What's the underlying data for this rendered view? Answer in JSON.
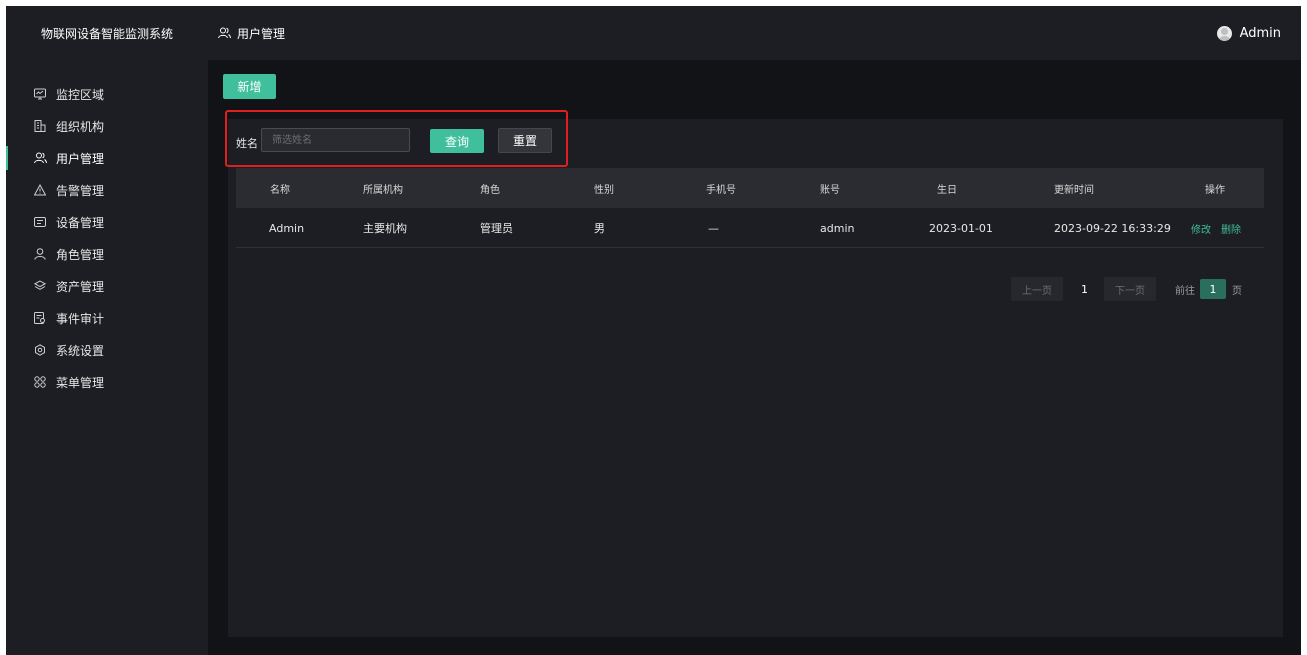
{
  "app": {
    "title": "物联网设备智能监测系统"
  },
  "sidebar": {
    "items": [
      {
        "label": "监控区域",
        "icon": "monitor-icon"
      },
      {
        "label": "组织机构",
        "icon": "building-icon"
      },
      {
        "label": "用户管理",
        "icon": "users-icon",
        "active": true
      },
      {
        "label": "告警管理",
        "icon": "warning-icon"
      },
      {
        "label": "设备管理",
        "icon": "device-icon"
      },
      {
        "label": "角色管理",
        "icon": "user-icon"
      },
      {
        "label": "资产管理",
        "icon": "layers-icon"
      },
      {
        "label": "事件审计",
        "icon": "audit-icon"
      },
      {
        "label": "系统设置",
        "icon": "gear-icon"
      },
      {
        "label": "菜单管理",
        "icon": "grid-icon"
      }
    ]
  },
  "header": {
    "page_title": "用户管理",
    "user_name": "Admin"
  },
  "toolbar": {
    "add_label": "新增"
  },
  "search": {
    "label": "姓名",
    "placeholder": "筛选姓名",
    "query_label": "查询",
    "reset_label": "重置"
  },
  "table": {
    "columns": [
      "名称",
      "所属机构",
      "角色",
      "性别",
      "手机号",
      "账号",
      "生日",
      "更新时间",
      "操作"
    ],
    "rows": [
      {
        "name": "Admin",
        "org": "主要机构",
        "role": "管理员",
        "gender": "男",
        "phone": "—",
        "account": "admin",
        "birthday": "2023-01-01",
        "updated": "2023-09-22 16:33:29",
        "edit_label": "修改",
        "delete_label": "删除"
      }
    ]
  },
  "pagination": {
    "prev_label": "上一页",
    "current_page": "1",
    "next_label": "下一页",
    "goto_prefix": "前往",
    "goto_value": "1",
    "goto_suffix": "页"
  },
  "colors": {
    "accent": "#3fbf9b",
    "background": "#111317",
    "panel": "#1d1e23",
    "highlight_border": "#e02020"
  }
}
